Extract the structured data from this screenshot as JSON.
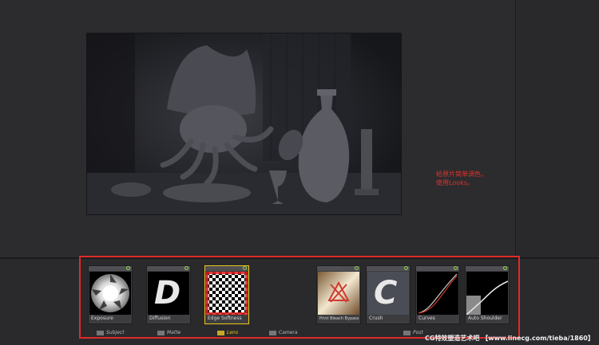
{
  "annotation": {
    "lines": [
      "给原片简单调色，",
      "使用Looks。"
    ]
  },
  "cards": [
    {
      "label": "Exposure",
      "icon": "aperture-icon"
    },
    {
      "label": "Diffusion",
      "icon": "letter-d-icon"
    },
    {
      "label": "Edge Softness",
      "icon": "checkerboard-icon"
    },
    {
      "label": "Print Bleach Bypass",
      "icon": "bleach-icon"
    },
    {
      "label": "Crush",
      "icon": "letter-c-icon"
    },
    {
      "label": "Curves",
      "icon": "curve-icon"
    },
    {
      "label": "Auto Shoulder",
      "icon": "shoulder-curve-icon"
    }
  ],
  "sections": {
    "subject": "Subject",
    "matte": "Matte",
    "lens": "Lens",
    "camera": "Camera",
    "post": "Post"
  },
  "thumb_glyphs": {
    "diffusion": "D",
    "crush": "C"
  },
  "watermark": "CG特效塑造艺术吧 【www.linecg.com/tieba/1860】",
  "colors": {
    "highlight_frame": "#e02a2a",
    "active_section": "#f0c419",
    "power_indicator": "#8fd24a",
    "annotation_text": "#e0312c"
  }
}
